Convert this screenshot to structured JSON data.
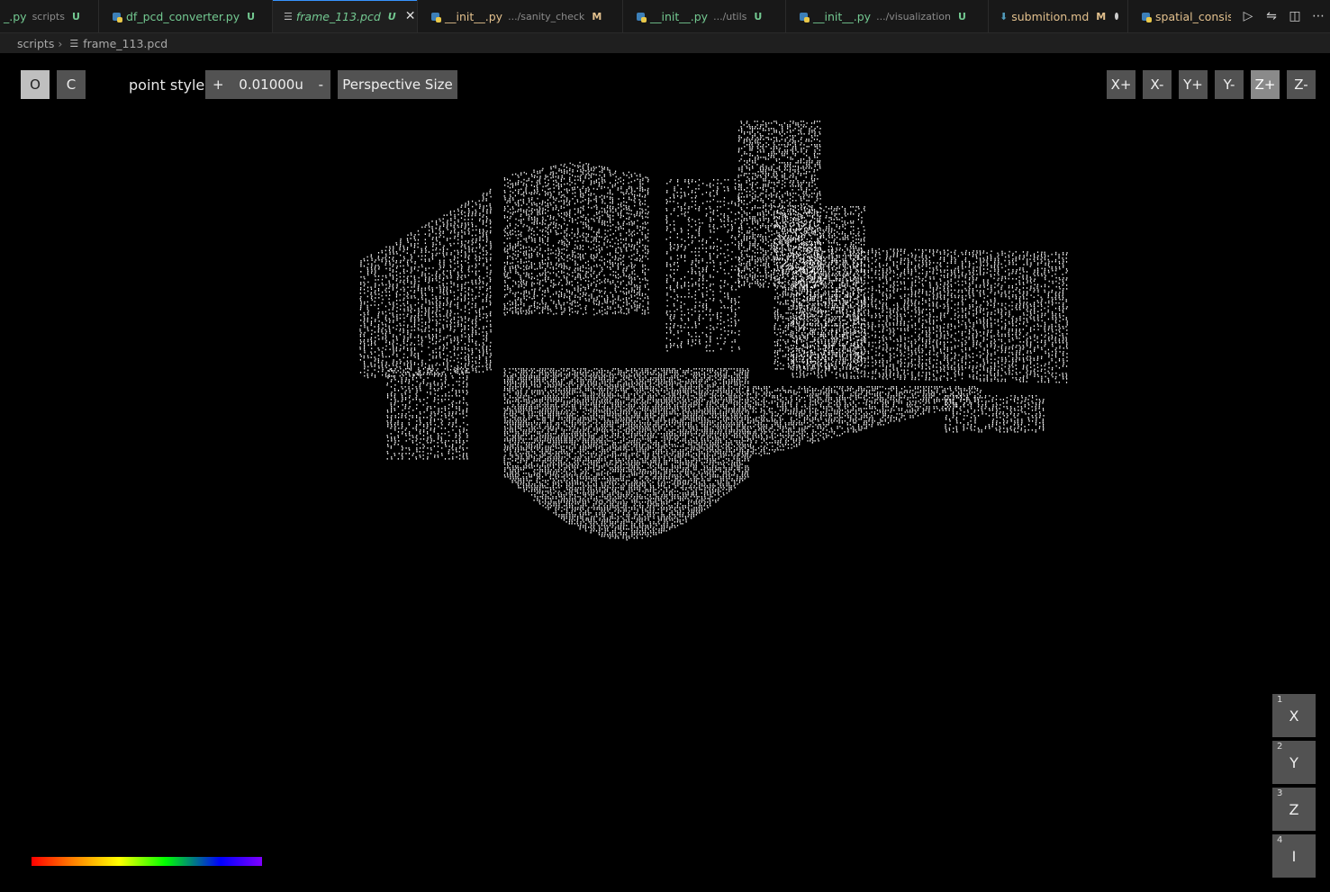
{
  "tabs": [
    {
      "name": "_.py",
      "desc": "scripts",
      "status": "U",
      "icon": "python-icon",
      "color": "green"
    },
    {
      "name": "df_pcd_converter.py",
      "desc": "",
      "status": "U",
      "icon": "python-icon",
      "color": "green"
    },
    {
      "name": "frame_113.pcd",
      "desc": "",
      "status": "U",
      "icon": "pcd-file-icon",
      "color": "green",
      "active": true
    },
    {
      "name": "__init__.py",
      "desc": ".../sanity_check",
      "status": "M",
      "icon": "python-icon",
      "color": "orange"
    },
    {
      "name": "__init__.py",
      "desc": ".../utils",
      "status": "U",
      "icon": "python-icon",
      "color": "green"
    },
    {
      "name": "__init__.py",
      "desc": ".../visualization",
      "status": "U",
      "icon": "python-icon",
      "color": "green"
    },
    {
      "name": "submition.md",
      "desc": "",
      "status": "M",
      "icon": "markdown-icon",
      "color": "orange",
      "dirty": true
    },
    {
      "name": "spatial_consis",
      "desc": "",
      "status": "",
      "icon": "python-icon",
      "color": "orange"
    }
  ],
  "breadcrumb": {
    "folder": "scripts",
    "file": "frame_113.pcd"
  },
  "viewer": {
    "ortho_label": "O",
    "camera_label": "C",
    "point_style_label": "point style",
    "plus_label": "+",
    "point_size_value": "0.01000u",
    "minus_label": "-",
    "perspective_label": "Perspective Size",
    "view_buttons": [
      "X+",
      "X-",
      "Y+",
      "Y-",
      "Z+",
      "Z-"
    ],
    "active_view": "Z+",
    "color_axes": [
      {
        "num": "1",
        "label": "X"
      },
      {
        "num": "2",
        "label": "Y"
      },
      {
        "num": "3",
        "label": "Z"
      },
      {
        "num": "4",
        "label": "I"
      }
    ]
  },
  "colors": {
    "background": "#000000",
    "points": "#ffffff",
    "button": "#525252",
    "button_active": "#bfbfbf"
  }
}
